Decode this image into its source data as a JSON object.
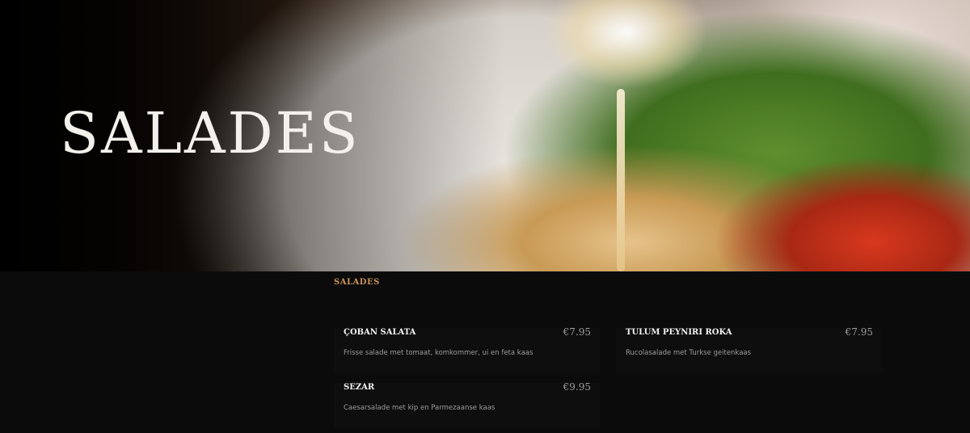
{
  "hero": {
    "title": "SALADES"
  },
  "menu": {
    "heading": "SALADES",
    "items": [
      {
        "name": "ÇOBAN SALATA",
        "price": "€7.95",
        "description": "Frisse salade met tomaat, komkommer, ui en feta kaas"
      },
      {
        "name": "TULUM PEYNIRI ROKA",
        "price": "€7.95",
        "description": "Rucolasalade met Turkse geitenkaas"
      },
      {
        "name": "SEZAR",
        "price": "€9.95",
        "description": "Caesarsalade met kip en Parmezaanse kaas"
      }
    ]
  }
}
